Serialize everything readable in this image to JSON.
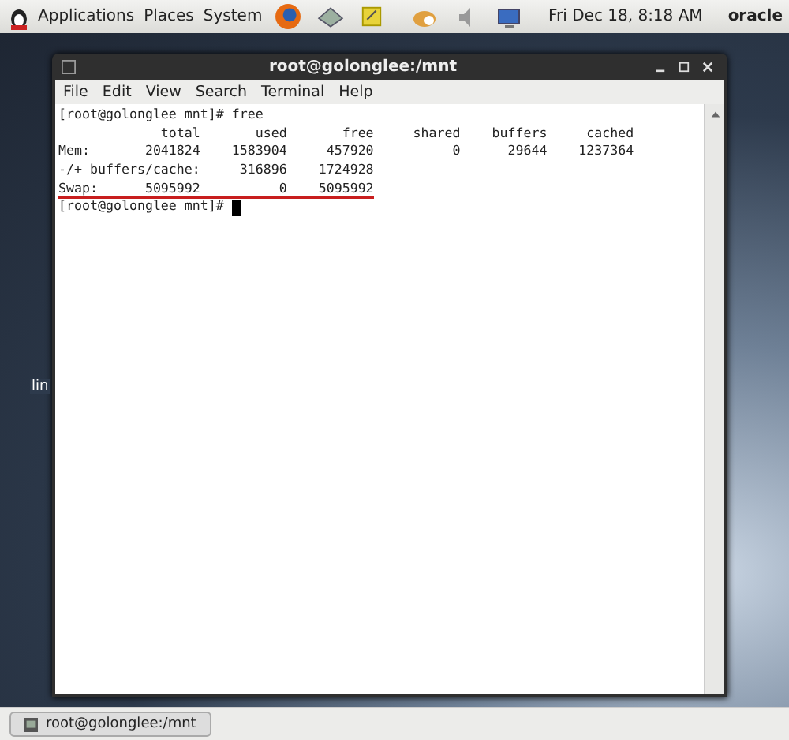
{
  "top_panel": {
    "menus": [
      "Applications",
      "Places",
      "System"
    ],
    "clock": "Fri Dec 18,  8:18 AM",
    "user": "oracle"
  },
  "desktop": {
    "icon_label": "lin"
  },
  "terminal": {
    "title": "root@golonglee:/mnt",
    "menu": [
      "File",
      "Edit",
      "View",
      "Search",
      "Terminal",
      "Help"
    ],
    "lines": [
      {
        "text": "[root@golonglee mnt]# free",
        "underlined": false
      },
      {
        "text": "             total       used       free     shared    buffers     cached",
        "underlined": false
      },
      {
        "text": "Mem:       2041824    1583904     457920          0      29644    1237364",
        "underlined": false
      },
      {
        "text": "-/+ buffers/cache:     316896    1724928",
        "underlined": false
      },
      {
        "text": "Swap:      5095992          0    5095992",
        "underlined": true
      },
      {
        "text": "[root@golonglee mnt]# ",
        "underlined": false,
        "cursor": true
      }
    ]
  },
  "taskbar": {
    "tasks": [
      {
        "label": "root@golonglee:/mnt",
        "selected": false
      }
    ]
  }
}
